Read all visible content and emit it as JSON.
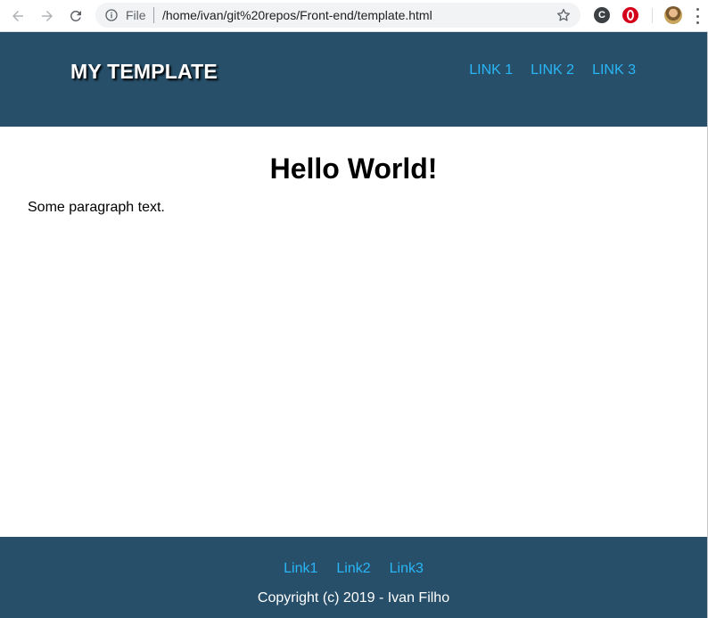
{
  "browser": {
    "scheme_label": "File",
    "url": "/home/ivan/git%20repos/Front-end/template.html",
    "extension_c_label": "C"
  },
  "header": {
    "brand": "MY TEMPLATE",
    "nav": [
      "LINK 1",
      "LINK 2",
      "LINK 3"
    ]
  },
  "main": {
    "heading": "Hello World!",
    "paragraph": "Some paragraph text."
  },
  "footer": {
    "links": [
      "Link1",
      "Link2",
      "Link3"
    ],
    "copyright": "Copyright (c) 2019 - Ivan Filho"
  },
  "colors": {
    "header_bg": "#274f69",
    "link": "#29b6f6",
    "brand_text": "#ffffff"
  },
  "icons": [
    "back-arrow-icon",
    "forward-arrow-icon",
    "reload-icon",
    "info-icon",
    "star-icon",
    "extension-icon",
    "opera-icon",
    "avatar",
    "menu-icon"
  ]
}
